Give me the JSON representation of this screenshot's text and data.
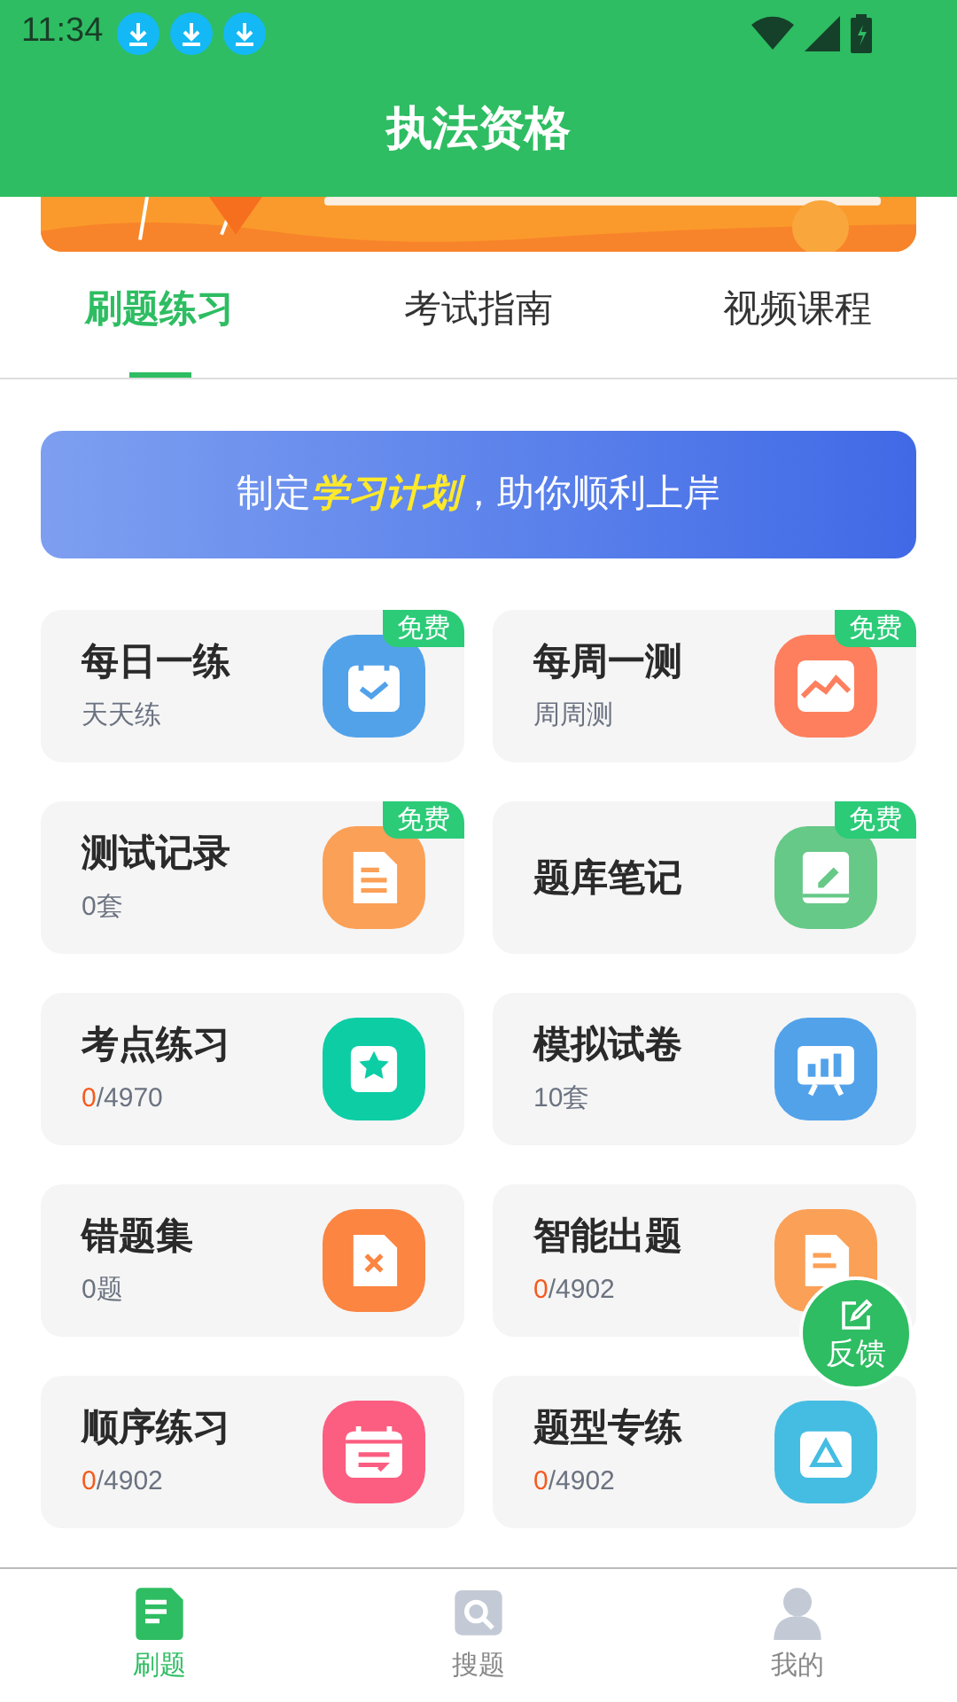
{
  "status_bar": {
    "time": "11:34"
  },
  "header": {
    "title": "执法资格"
  },
  "tabs": [
    {
      "label": "刷题练习",
      "selected": true
    },
    {
      "label": "考试指南",
      "selected": false
    },
    {
      "label": "视频课程",
      "selected": false
    }
  ],
  "plan_banner": {
    "text": "制定**学习计划**，助你顺利上岸"
  },
  "cards": [
    {
      "title": "每日一练",
      "subtitle": "天天练",
      "badge": "免费",
      "color": "#52a2ea"
    },
    {
      "title": "每周一测",
      "subtitle": "周周测",
      "badge": "免费",
      "color": "#fd7f5e"
    },
    {
      "title": "测试记录",
      "subtitle": "0套",
      "badge": "免费",
      "color": "#fba057"
    },
    {
      "title": "题库笔记",
      "badge": "免费",
      "color": "#66c987"
    },
    {
      "title": "考点练习",
      "progress": {
        "done": "0",
        "total": "/4970"
      },
      "color": "#0dcda5"
    },
    {
      "title": "模拟试卷",
      "subtitle": "10套",
      "color": "#52a2ea"
    },
    {
      "title": "错题集",
      "subtitle": "0题",
      "color": "#fb8541"
    },
    {
      "title": "智能出题",
      "progress": {
        "done": "0",
        "total": "/4902"
      },
      "color": "#fba057"
    },
    {
      "title": "顺序练习",
      "progress": {
        "done": "0",
        "total": "/4902"
      },
      "color": "#fb5e80"
    },
    {
      "title": "题型专练",
      "progress": {
        "done": "0",
        "total": "/4902"
      },
      "color": "#45bde2"
    }
  ],
  "feedback_button": {
    "label": "反馈"
  },
  "bottom_nav": [
    {
      "label": "刷题",
      "selected": true
    },
    {
      "label": "搜题",
      "selected": false
    },
    {
      "label": "我的",
      "selected": false
    }
  ]
}
